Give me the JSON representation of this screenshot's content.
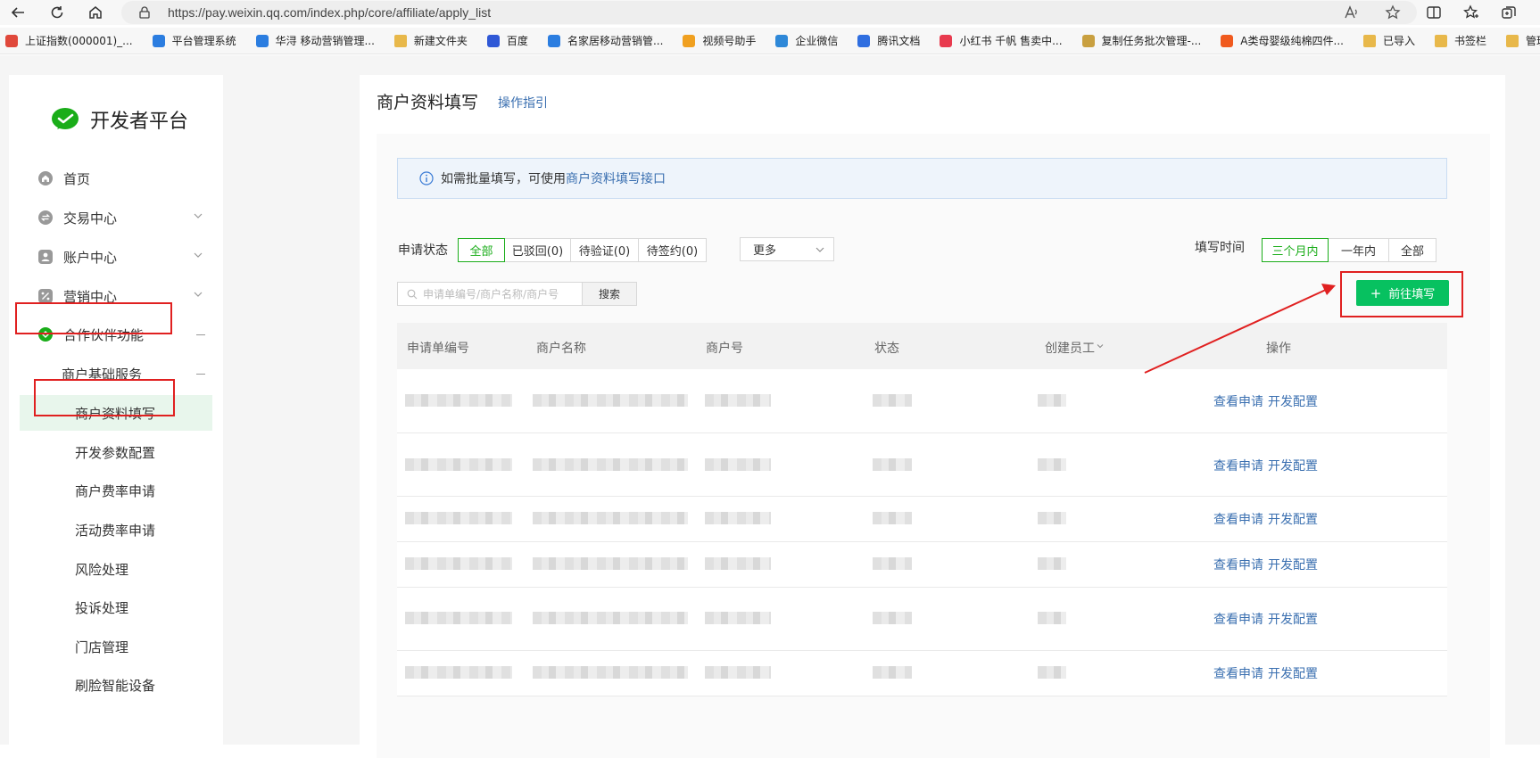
{
  "browser": {
    "url": "https://pay.weixin.qq.com/index.php/core/affiliate/apply_list"
  },
  "bookmarks": [
    {
      "label": "上证指数(000001)_...",
      "color": "#e0483b"
    },
    {
      "label": "平台管理系统",
      "color": "#2b7de0"
    },
    {
      "label": "华浔 移动营销管理...",
      "color": "#2b7de0"
    },
    {
      "label": "新建文件夹",
      "color": "#e8b84a"
    },
    {
      "label": "百度",
      "color": "#2f58d6"
    },
    {
      "label": "名家居移动营销管...",
      "color": "#2b7de0"
    },
    {
      "label": "视频号助手",
      "color": "#f0a020"
    },
    {
      "label": "企业微信",
      "color": "#2e88d8"
    },
    {
      "label": "腾讯文档",
      "color": "#2f6ee0"
    },
    {
      "label": "小红书 千帆 售卖中...",
      "color": "#e83a4e"
    },
    {
      "label": "复制任务批次管理-...",
      "color": "#c9a040"
    },
    {
      "label": "A类母婴级纯棉四件...",
      "color": "#f05a1e"
    },
    {
      "label": "已导入",
      "color": "#e8b84a"
    },
    {
      "label": "书签栏",
      "color": "#e8b84a"
    },
    {
      "label": "管理后台",
      "color": "#e8b84a"
    }
  ],
  "sidebar": {
    "logo_text": "开发者平台",
    "items": [
      {
        "label": "首页",
        "icon": "home-icon"
      },
      {
        "label": "交易中心",
        "icon": "exchange-icon"
      },
      {
        "label": "账户中心",
        "icon": "account-icon"
      },
      {
        "label": "营销中心",
        "icon": "percent-icon"
      },
      {
        "label": "合作伙伴功能",
        "icon": "partner-icon"
      }
    ],
    "group_label": "商户基础服务",
    "sub_items": [
      "商户资料填写",
      "开发参数配置",
      "商户费率申请",
      "活动费率申请",
      "风险处理",
      "投诉处理",
      "门店管理",
      "刷脸智能设备"
    ]
  },
  "main": {
    "title": "商户资料填写",
    "guide_link": "操作指引",
    "notice_text": "如需批量填写，可使用",
    "notice_link": "商户资料填写接口",
    "status_label": "申请状态",
    "status_tabs": [
      "全部",
      "已驳回(0)",
      "待验证(0)",
      "待签约(0)"
    ],
    "more_label": "更多",
    "time_label": "填写时间",
    "time_tabs": [
      "三个月内",
      "一年内",
      "全部"
    ],
    "search_placeholder": "申请单编号/商户名称/商户号",
    "search_button": "搜索",
    "add_button": "前往填写",
    "columns": [
      "申请单编号",
      "商户名称",
      "商户号",
      "状态",
      "创建员工",
      "操作"
    ],
    "row_action_view": "查看申请",
    "row_action_config": "开发配置",
    "accent_green": "#07c160",
    "link_blue": "#3a6fb0",
    "highlight_red": "#e02020"
  }
}
